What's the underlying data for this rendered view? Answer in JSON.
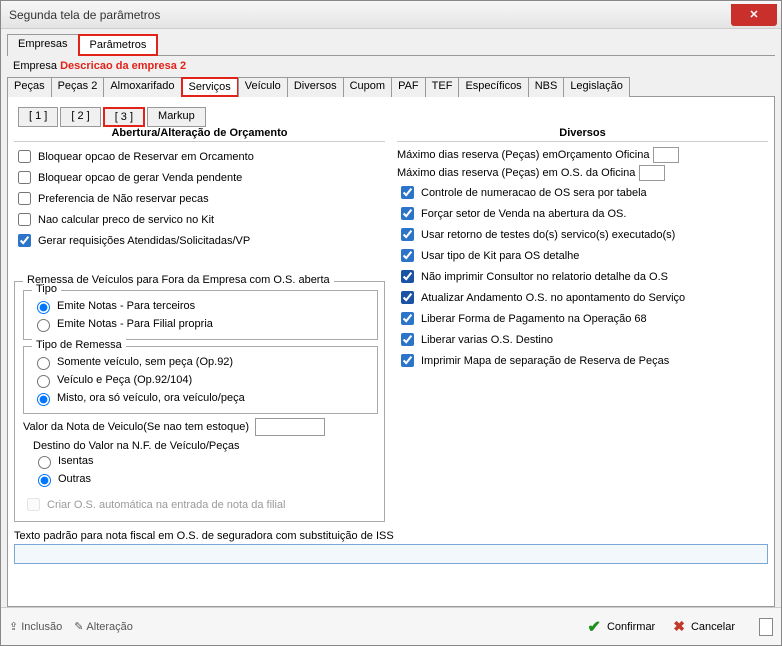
{
  "window": {
    "title": "Segunda tela de parâmetros"
  },
  "topTabs": {
    "empresas": "Empresas",
    "parametros": "Parâmetros"
  },
  "empresa": {
    "label": "Empresa",
    "desc": "Descricao da empresa 2"
  },
  "subTabs": {
    "pecas": "Peças",
    "pecas2": "Peças 2",
    "almox": "Almoxarifado",
    "servicos": "Serviços",
    "veiculo": "Veículo",
    "diversos": "Diversos",
    "cupom": "Cupom",
    "paf": "PAF",
    "tef": "TEF",
    "espec": "Específicos",
    "nbs": "NBS",
    "legis": "Legislação"
  },
  "l3": {
    "t1": "[ 1 ]",
    "t2": "[ 2 ]",
    "t3": "[ 3 ]",
    "markup": "Markup"
  },
  "left": {
    "heading": "Abertura/Alteração de  Orçamento",
    "bloq_reservar": "Bloquear opcao de Reservar em Orcamento",
    "bloq_venda": "Bloquear opcao de gerar Venda pendente",
    "pref_nao_reservar": "Preferencia de Não reservar pecas",
    "nao_calc": "Nao calcular preco de servico no Kit",
    "gerar_req": "Gerar requisições Atendidas/Solicitadas/VP",
    "remessa_legend": "Remessa de Veículos para Fora da Empresa com O.S. aberta",
    "tipo_legend": "Tipo",
    "tipo_r1": "Emite Notas  - Para terceiros",
    "tipo_r2": "Emite Notas  - Para Filial propria",
    "tipor_legend": "Tipo de Remessa",
    "tr1": "Somente veículo, sem peça (Op.92)",
    "tr2": "Veículo e Peça (Op.92/104)",
    "tr3": "Misto, ora só veículo, ora veículo/peça",
    "val_label": "Valor da Nota de Veiculo(Se nao tem estoque)",
    "dest_label": "Destino do Valor na N.F. de Veículo/Peças",
    "dest_r1": "Isentas",
    "dest_r2": "Outras",
    "criar_os": "Criar O.S. automática na entrada de nota da filial"
  },
  "right": {
    "heading": "Diversos",
    "max_orc": "Máximo dias reserva (Peças) emOrçamento Oficina",
    "max_os": "Máximo dias reserva (Peças) em O.S. da Oficina",
    "ctrl_num": "Controle de numeracao de OS sera por tabela",
    "forcar_setor": "Forçar setor de Venda na abertura da OS.",
    "usar_retorno": "Usar retorno de testes do(s) servico(s) executado(s)",
    "usar_kit": "Usar tipo de Kit para OS detalhe",
    "nao_imprimir": "Não imprimir Consultor no relatorio detalhe da O.S",
    "atualizar": "Atualizar Andamento O.S. no apontamento do Serviço",
    "liberar_fp": "Liberar Forma de Pagamento na Operação 68",
    "liberar_varias": "Liberar varias O.S. Destino",
    "imprimir_mapa": "Imprimir Mapa de separação de Reserva de Peças"
  },
  "texto": {
    "label": "Texto padrão para nota fiscal em O.S. de seguradora com substituição de ISS",
    "value": ""
  },
  "footer": {
    "inclusao": "Inclusão",
    "alteracao": "Alteração",
    "confirmar": "Confirmar",
    "cancelar": "Cancelar"
  }
}
